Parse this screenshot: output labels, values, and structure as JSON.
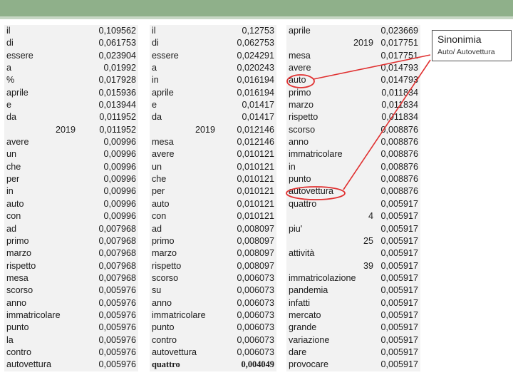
{
  "legend": {
    "title": "Sinonimia",
    "subtitle": "Auto/ Autovettura"
  },
  "table1": {
    "rows": [
      {
        "w": "il",
        "v": "0,109562"
      },
      {
        "w": "di",
        "v": "0,061753"
      },
      {
        "w": "essere",
        "v": "0,023904"
      },
      {
        "w": "a",
        "v": "0,01992"
      },
      {
        "w": "%",
        "v": "0,017928"
      },
      {
        "w": "aprile",
        "v": "0,015936"
      },
      {
        "w": "e",
        "v": "0,013944"
      },
      {
        "w": "da",
        "v": "0,011952"
      },
      {
        "w": "2019",
        "v": "0,011952",
        "num": true
      },
      {
        "w": "avere",
        "v": "0,00996"
      },
      {
        "w": "un",
        "v": "0,00996"
      },
      {
        "w": "che",
        "v": "0,00996"
      },
      {
        "w": "per",
        "v": "0,00996"
      },
      {
        "w": "in",
        "v": "0,00996"
      },
      {
        "w": "auto",
        "v": "0,00996"
      },
      {
        "w": "con",
        "v": "0,00996"
      },
      {
        "w": "ad",
        "v": "0,007968"
      },
      {
        "w": "primo",
        "v": "0,007968"
      },
      {
        "w": "marzo",
        "v": "0,007968"
      },
      {
        "w": "rispetto",
        "v": "0,007968"
      },
      {
        "w": "mesa",
        "v": "0,007968"
      },
      {
        "w": "scorso",
        "v": "0,005976"
      },
      {
        "w": "anno",
        "v": "0,005976"
      },
      {
        "w": "immatricolare",
        "v": "0,005976"
      },
      {
        "w": "punto",
        "v": "0,005976"
      },
      {
        "w": "la",
        "v": "0,005976"
      },
      {
        "w": "contro",
        "v": "0,005976"
      },
      {
        "w": "autovettura",
        "v": "0,005976"
      }
    ]
  },
  "table2": {
    "rows": [
      {
        "w": "il",
        "v": "0,12753"
      },
      {
        "w": "di",
        "v": "0,062753"
      },
      {
        "w": "essere",
        "v": "0,024291"
      },
      {
        "w": "a",
        "v": "0,020243"
      },
      {
        "w": "in",
        "v": "0,016194"
      },
      {
        "w": "aprile",
        "v": "0,016194"
      },
      {
        "w": "e",
        "v": "0,01417"
      },
      {
        "w": "da",
        "v": "0,01417"
      },
      {
        "w": "2019",
        "v": "0,012146",
        "num": true
      },
      {
        "w": "mesa",
        "v": "0,012146"
      },
      {
        "w": "avere",
        "v": "0,010121"
      },
      {
        "w": "un",
        "v": "0,010121"
      },
      {
        "w": "che",
        "v": "0,010121"
      },
      {
        "w": "per",
        "v": "0,010121"
      },
      {
        "w": "auto",
        "v": "0,010121"
      },
      {
        "w": "con",
        "v": "0,010121"
      },
      {
        "w": "ad",
        "v": "0,008097"
      },
      {
        "w": "primo",
        "v": "0,008097"
      },
      {
        "w": "marzo",
        "v": "0,008097"
      },
      {
        "w": "rispetto",
        "v": "0,008097"
      },
      {
        "w": "scorso",
        "v": "0,006073"
      },
      {
        "w": "su",
        "v": "0,006073"
      },
      {
        "w": "anno",
        "v": "0,006073"
      },
      {
        "w": "immatricolare",
        "v": "0,006073"
      },
      {
        "w": "punto",
        "v": "0,006073"
      },
      {
        "w": "contro",
        "v": "0,006073"
      },
      {
        "w": "autovettura",
        "v": "0,006073"
      },
      {
        "w": "quattro",
        "v": "0,004049",
        "bold": true
      }
    ]
  },
  "table3": {
    "rows": [
      {
        "w": "aprile",
        "v": "0,023669"
      },
      {
        "w": "2019",
        "v": "0,017751",
        "num": true
      },
      {
        "w": "mesa",
        "v": "0,017751"
      },
      {
        "w": "avere",
        "v": "0,014793"
      },
      {
        "w": "auto",
        "v": "0,014793"
      },
      {
        "w": "primo",
        "v": "0,011834"
      },
      {
        "w": "marzo",
        "v": "0,011834"
      },
      {
        "w": "rispetto",
        "v": "0,011834"
      },
      {
        "w": "scorso",
        "v": "0,008876"
      },
      {
        "w": "anno",
        "v": "0,008876"
      },
      {
        "w": "immatricolare",
        "v": "0,008876"
      },
      {
        "w": "in",
        "v": "0,008876"
      },
      {
        "w": "punto",
        "v": "0,008876"
      },
      {
        "w": "autovettura",
        "v": "0,008876"
      },
      {
        "w": "quattro",
        "v": "0,005917"
      },
      {
        "w": "4",
        "v": "0,005917",
        "num": true
      },
      {
        "w": "piu'",
        "v": "0,005917"
      },
      {
        "w": "25",
        "v": "0,005917",
        "num": true
      },
      {
        "w": "attività",
        "v": "0,005917"
      },
      {
        "w": "39",
        "v": "0,005917",
        "num": true
      },
      {
        "w": "immatricolazione",
        "v": "0,005917"
      },
      {
        "w": "pandemia",
        "v": "0,005917"
      },
      {
        "w": "infatti",
        "v": "0,005917"
      },
      {
        "w": "mercato",
        "v": "0,005917"
      },
      {
        "w": "grande",
        "v": "0,005917"
      },
      {
        "w": "variazione",
        "v": "0,005917"
      },
      {
        "w": "dare",
        "v": "0,005917"
      },
      {
        "w": "provocare",
        "v": "0,005917"
      }
    ]
  },
  "colors": {
    "header_bar": "#8fb08a",
    "table_bg": "#f2f2f2",
    "highlight": "#e03030"
  }
}
